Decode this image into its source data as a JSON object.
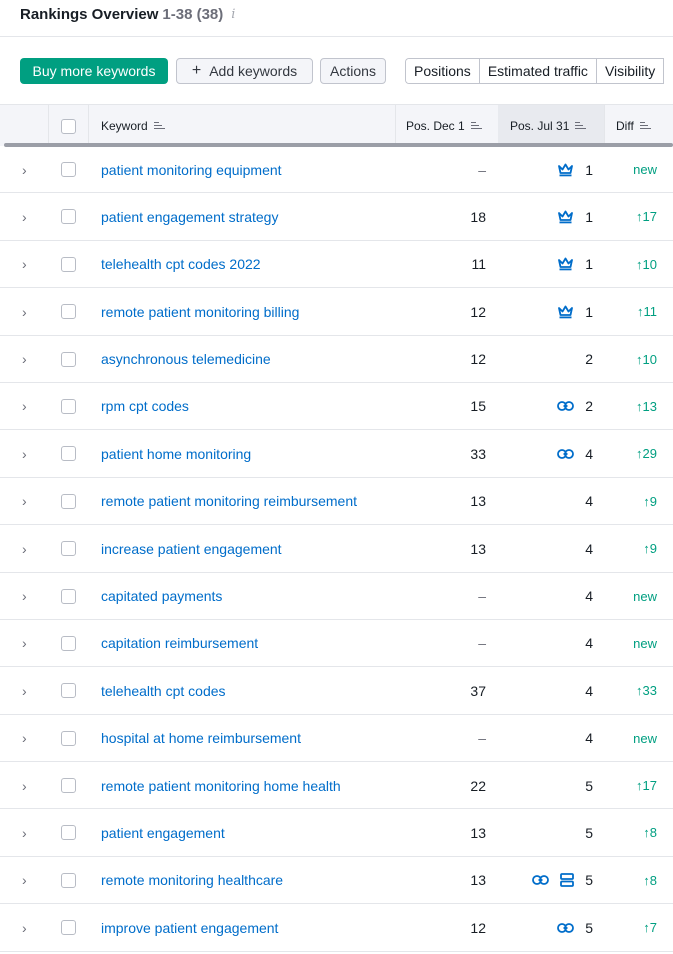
{
  "header": {
    "title": "Rankings Overview",
    "count": "1-38 (38)",
    "info_glyph": "i"
  },
  "toolbar": {
    "buy_label": "Buy more keywords",
    "add_label": "Add keywords",
    "actions_label": "Actions",
    "tabs": [
      "Positions",
      "Estimated traffic",
      "Visibility"
    ]
  },
  "columns": {
    "keyword": "Keyword",
    "pos_a": "Pos. Dec 1",
    "pos_b": "Pos. Jul 31",
    "diff": "Diff"
  },
  "colors": {
    "accent": "#009f81",
    "link": "#006dca",
    "icon": "#006dca"
  },
  "rows": [
    {
      "keyword": "patient monitoring equipment",
      "pos_a": "–",
      "pos_b": "1",
      "icons": [
        "crown-icon"
      ],
      "diff": "new"
    },
    {
      "keyword": "patient engagement strategy",
      "pos_a": "18",
      "pos_b": "1",
      "icons": [
        "crown-icon"
      ],
      "diff": "↑17"
    },
    {
      "keyword": "telehealth cpt codes 2022",
      "pos_a": "11",
      "pos_b": "1",
      "icons": [
        "crown-icon"
      ],
      "diff": "↑10"
    },
    {
      "keyword": "remote patient monitoring billing",
      "pos_a": "12",
      "pos_b": "1",
      "icons": [
        "crown-icon"
      ],
      "diff": "↑11"
    },
    {
      "keyword": "asynchronous telemedicine",
      "pos_a": "12",
      "pos_b": "2",
      "icons": [],
      "diff": "↑10"
    },
    {
      "keyword": "rpm cpt codes",
      "pos_a": "15",
      "pos_b": "2",
      "icons": [
        "link-icon"
      ],
      "diff": "↑13"
    },
    {
      "keyword": "patient home monitoring",
      "pos_a": "33",
      "pos_b": "4",
      "icons": [
        "link-icon"
      ],
      "diff": "↑29"
    },
    {
      "keyword": "remote patient monitoring reimbursement",
      "pos_a": "13",
      "pos_b": "4",
      "icons": [],
      "diff": "↑9"
    },
    {
      "keyword": "increase patient engagement",
      "pos_a": "13",
      "pos_b": "4",
      "icons": [],
      "diff": "↑9"
    },
    {
      "keyword": "capitated payments",
      "pos_a": "–",
      "pos_b": "4",
      "icons": [],
      "diff": "new"
    },
    {
      "keyword": "capitation reimbursement",
      "pos_a": "–",
      "pos_b": "4",
      "icons": [],
      "diff": "new"
    },
    {
      "keyword": "telehealth cpt codes",
      "pos_a": "37",
      "pos_b": "4",
      "icons": [],
      "diff": "↑33"
    },
    {
      "keyword": "hospital at home reimbursement",
      "pos_a": "–",
      "pos_b": "4",
      "icons": [],
      "diff": "new"
    },
    {
      "keyword": "remote patient monitoring home health",
      "pos_a": "22",
      "pos_b": "5",
      "icons": [],
      "diff": "↑17"
    },
    {
      "keyword": "patient engagement",
      "pos_a": "13",
      "pos_b": "5",
      "icons": [],
      "diff": "↑8"
    },
    {
      "keyword": "remote monitoring healthcare",
      "pos_a": "13",
      "pos_b": "5",
      "icons": [
        "link-icon",
        "sitelinks-icon"
      ],
      "diff": "↑8"
    },
    {
      "keyword": "improve patient engagement",
      "pos_a": "12",
      "pos_b": "5",
      "icons": [
        "link-icon"
      ],
      "diff": "↑7"
    }
  ]
}
